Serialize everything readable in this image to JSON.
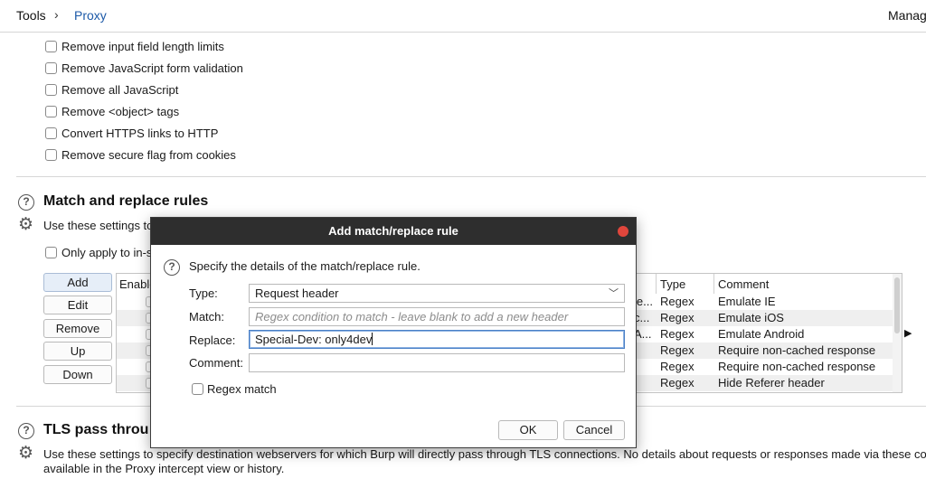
{
  "header": {
    "root": "Tools",
    "separator": "›",
    "current": "Proxy",
    "right": "Manage"
  },
  "options": [
    "Remove input field length limits",
    "Remove JavaScript form validation",
    "Remove all JavaScript",
    "Remove <object> tags",
    "Convert HTTPS links to HTTP",
    "Remove secure flag from cookies"
  ],
  "match_replace": {
    "title": "Match and replace rules",
    "description": "Use these settings to",
    "only_apply": "Only apply to in-s",
    "buttons": [
      "Add",
      "Edit",
      "Remove",
      "Up",
      "Down"
    ],
    "columns": {
      "enabled": "Enable",
      "type": "Type",
      "comment": "Comment"
    },
    "rows": [
      {
        "item": "le...",
        "type": "Regex",
        "comment": "Emulate IE"
      },
      {
        "item": "c...",
        "type": "Regex",
        "comment": "Emulate iOS"
      },
      {
        "item": "A...",
        "type": "Regex",
        "comment": "Emulate Android"
      },
      {
        "item": "",
        "type": "Regex",
        "comment": "Require non-cached response"
      },
      {
        "item": "",
        "type": "Regex",
        "comment": "Require non-cached response"
      },
      {
        "item": "",
        "type": "Regex",
        "comment": "Hide Referer header"
      }
    ]
  },
  "tls": {
    "title": "TLS pass throu",
    "description_line1": "Use these settings to specify destination webservers for which Burp will directly pass through TLS connections. No details about requests or responses made via these co",
    "description_line2": "available in the Proxy intercept view or history."
  },
  "dialog": {
    "title": "Add match/replace rule",
    "intro": "Specify the details of the match/replace rule.",
    "type_label": "Type:",
    "type_value": "Request header",
    "match_label": "Match:",
    "match_placeholder": "Regex condition to match - leave blank to add a new header",
    "replace_label": "Replace:",
    "replace_value": "Special-Dev: only4dev",
    "comment_label": "Comment:",
    "comment_value": "",
    "regex_label": "Regex match",
    "ok": "OK",
    "cancel": "Cancel"
  }
}
